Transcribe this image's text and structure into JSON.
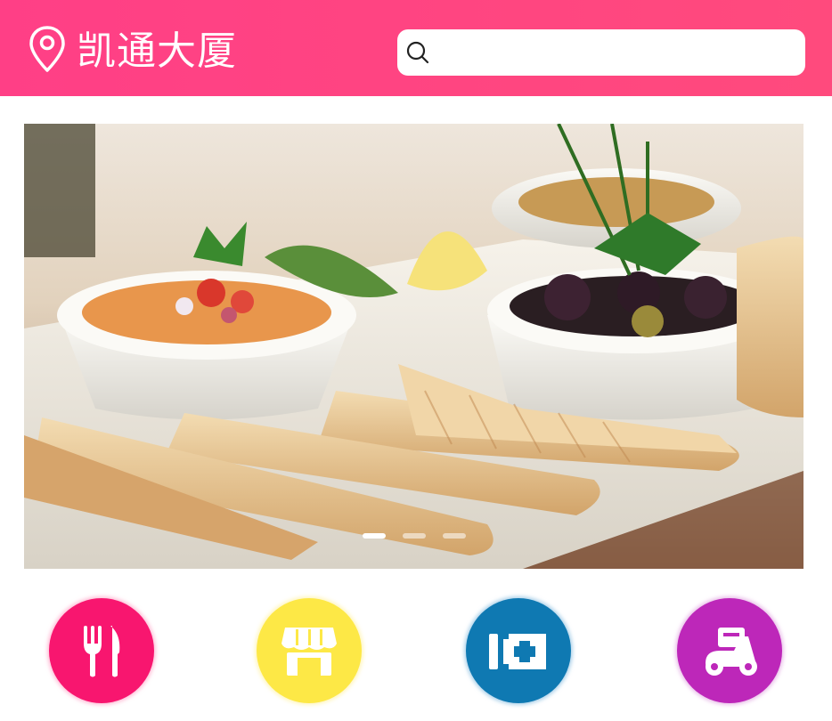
{
  "header": {
    "location_name": "凯通大厦",
    "search": {
      "value": "",
      "placeholder": ""
    }
  },
  "banner": {
    "slide_count": 3,
    "active_slide": 1
  },
  "categories": [
    {
      "icon": "fork-knife-icon",
      "color": "#f8166f"
    },
    {
      "icon": "storefront-icon",
      "color": "#fde846"
    },
    {
      "icon": "medical-cross-icon",
      "color": "#0f79b2"
    },
    {
      "icon": "scooter-icon",
      "color": "#bd27b9"
    }
  ],
  "colors": {
    "header_accent": "#ff4080",
    "background": "#ffffff"
  }
}
